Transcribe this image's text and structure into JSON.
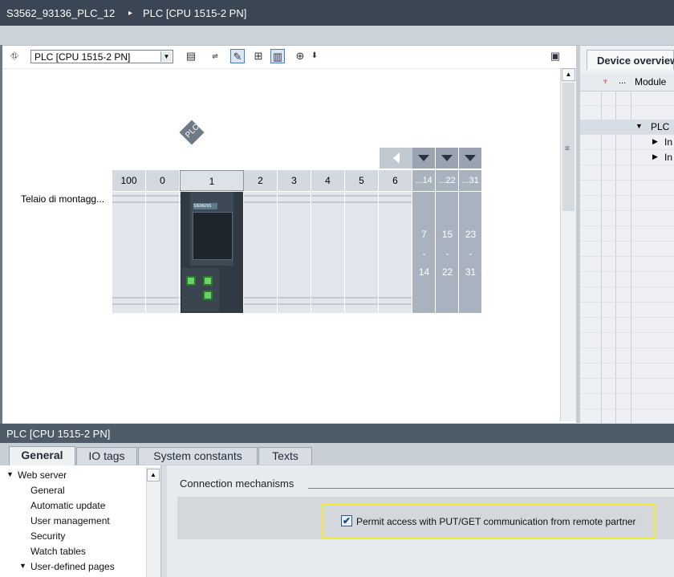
{
  "breadcrumb": {
    "project": "S3562_93136_PLC_12",
    "separator": "▸",
    "device": "PLC [CPU 1515-2 PN]"
  },
  "device_view": {
    "device_selector": {
      "value": "PLC [CPU 1515-2 PN]"
    },
    "plc_label": "PLC",
    "rack_label": "Telaio di montagg...",
    "slots": [
      "100",
      "0",
      "1",
      "2",
      "3",
      "4",
      "5",
      "6"
    ],
    "groups": [
      {
        "header": "...14",
        "from": "7",
        "dash": "-",
        "to": "14"
      },
      {
        "header": "...22",
        "from": "15",
        "dash": "-",
        "to": "22"
      },
      {
        "header": "...31",
        "from": "23",
        "dash": "-",
        "to": "31"
      }
    ],
    "cpu_brand": "SIEMENS"
  },
  "device_overview": {
    "tab_label": "Device overview",
    "columns": {
      "dots": "...",
      "module": "Module"
    },
    "rows": [
      {
        "label": "PLC",
        "arrow": "▼"
      },
      {
        "label": "In",
        "arrow": "▶"
      },
      {
        "label": "In",
        "arrow": "▶"
      }
    ]
  },
  "properties": {
    "title": "PLC [CPU 1515-2 PN]",
    "tabs": [
      "General",
      "IO tags",
      "System constants",
      "Texts"
    ],
    "tree": [
      {
        "label": "Web server",
        "level": 0,
        "expander": "▼"
      },
      {
        "label": "General",
        "level": 1
      },
      {
        "label": "Automatic update",
        "level": 1
      },
      {
        "label": "User management",
        "level": 1
      },
      {
        "label": "Security",
        "level": 1
      },
      {
        "label": "Watch tables",
        "level": 1
      },
      {
        "label": "User-defined pages",
        "level": 1,
        "expander": "▼"
      }
    ],
    "section_title": "Connection mechanisms",
    "checkbox": {
      "label": "Permit access with PUT/GET communication from remote partner",
      "checked": true,
      "mark": "✔"
    }
  },
  "colors": {
    "highlight": "#f2ea2a",
    "title_bar": "#3a4653",
    "rack_group": "#a9b3c0"
  }
}
